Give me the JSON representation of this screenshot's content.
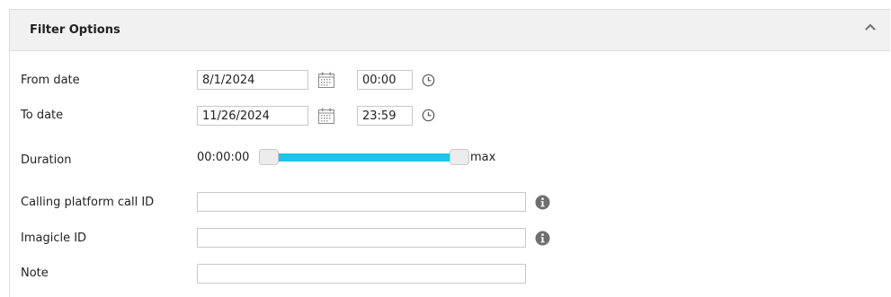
{
  "panel": {
    "title": "Filter Options"
  },
  "icons": {
    "collapse": "chevron-up-icon",
    "calendar": "calendar-icon",
    "clock": "clock-icon",
    "info": "info-icon"
  },
  "filters": {
    "from_date": {
      "label": "From date",
      "date": "8/1/2024",
      "time": "00:00"
    },
    "to_date": {
      "label": "To date",
      "date": "11/26/2024",
      "time": "23:59"
    },
    "duration": {
      "label": "Duration",
      "min_text": "00:00:00",
      "max_text": "max",
      "range_start": 0,
      "range_end": 1
    },
    "call_id": {
      "label": "Calling platform call ID",
      "value": ""
    },
    "imagicle_id": {
      "label": "Imagicle ID",
      "value": ""
    },
    "note": {
      "label": "Note",
      "value": ""
    }
  },
  "colors": {
    "accent": "#1fc3ec",
    "header_bg": "#f1f1f1"
  }
}
